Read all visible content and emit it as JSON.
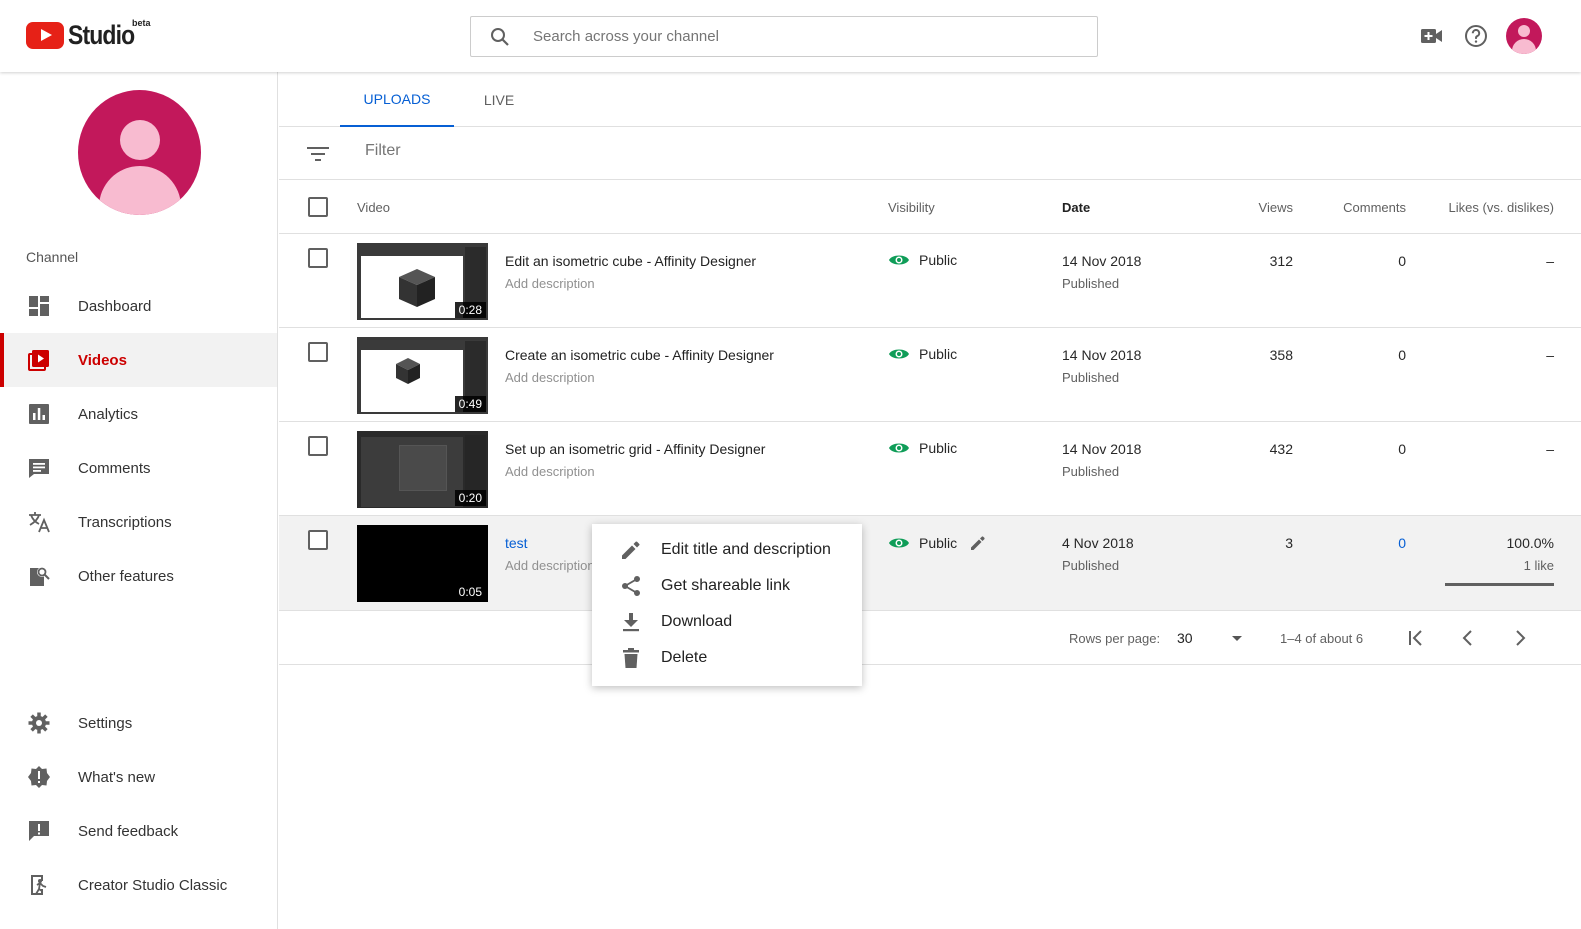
{
  "header": {
    "logo_text": "Studio",
    "logo_badge": "beta",
    "search_placeholder": "Search across your channel"
  },
  "sidebar": {
    "section_label": "Channel",
    "items": [
      {
        "label": "Dashboard",
        "icon": "dashboard-icon"
      },
      {
        "label": "Videos",
        "icon": "videos-icon",
        "active": true
      },
      {
        "label": "Analytics",
        "icon": "analytics-icon"
      },
      {
        "label": "Comments",
        "icon": "comments-icon"
      },
      {
        "label": "Transcriptions",
        "icon": "translate-icon"
      },
      {
        "label": "Other features",
        "icon": "other-features-icon"
      }
    ],
    "bottom_items": [
      {
        "label": "Settings",
        "icon": "gear-icon"
      },
      {
        "label": "What's new",
        "icon": "whats-new-icon"
      },
      {
        "label": "Send feedback",
        "icon": "feedback-icon"
      },
      {
        "label": "Creator Studio Classic",
        "icon": "exit-icon"
      }
    ]
  },
  "tabs": [
    {
      "label": "UPLOADS",
      "active": true
    },
    {
      "label": "LIVE"
    }
  ],
  "filter_placeholder": "Filter",
  "table": {
    "columns": [
      "Video",
      "Visibility",
      "Date",
      "Views",
      "Comments",
      "Likes (vs. dislikes)"
    ],
    "rows": [
      {
        "title": "Edit an isometric cube - Affinity Designer",
        "description": "Add description",
        "duration": "0:28",
        "visibility": "Public",
        "date": "14 Nov 2018",
        "status": "Published",
        "views": "312",
        "comments": "0",
        "likes": "–"
      },
      {
        "title": "Create an isometric cube - Affinity Designer",
        "description": "Add description",
        "duration": "0:49",
        "visibility": "Public",
        "date": "14 Nov 2018",
        "status": "Published",
        "views": "358",
        "comments": "0",
        "likes": "–"
      },
      {
        "title": "Set up an isometric grid - Affinity Designer",
        "description": "Add description",
        "duration": "0:20",
        "visibility": "Public",
        "date": "14 Nov 2018",
        "status": "Published",
        "views": "432",
        "comments": "0",
        "likes": "–"
      },
      {
        "title": "test",
        "description": "Add description",
        "duration": "0:05",
        "visibility": "Public",
        "date": "4 Nov 2018",
        "status": "Published",
        "views": "3",
        "comments": "0",
        "likes": "100.0%",
        "likes_detail": "1 like",
        "like_ratio": 1.0
      }
    ]
  },
  "pagination": {
    "rows_per_page_label": "Rows per page:",
    "rows_per_page": "30",
    "range": "1–4 of about 6"
  },
  "context_menu": [
    {
      "label": "Edit title and description",
      "icon": "pencil-icon"
    },
    {
      "label": "Get shareable link",
      "icon": "share-icon"
    },
    {
      "label": "Download",
      "icon": "download-icon"
    },
    {
      "label": "Delete",
      "icon": "trash-icon"
    }
  ],
  "colors": {
    "brand_red": "#cc0000",
    "accent_blue": "#065fd4",
    "public_green": "#0f9d58",
    "avatar": "#c2185b"
  }
}
